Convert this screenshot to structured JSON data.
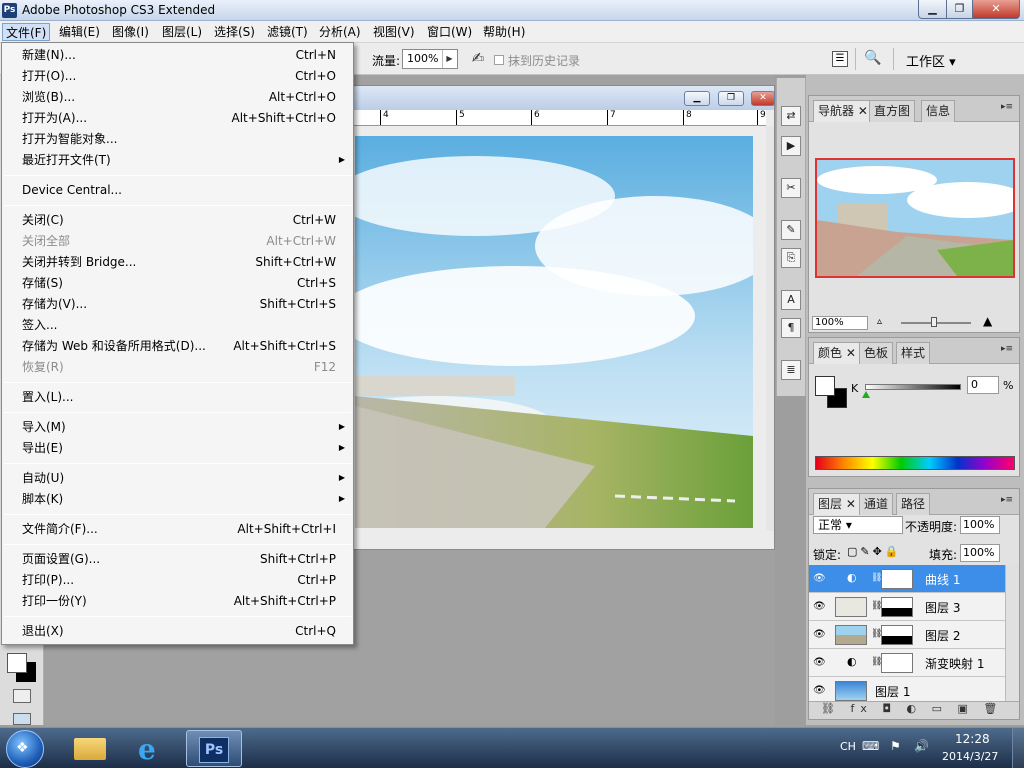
{
  "window": {
    "title": "Adobe Photoshop CS3 Extended",
    "logo": "Ps",
    "min": "▁",
    "max": "❐",
    "close": "✕"
  },
  "menubar": [
    "文件(F)",
    "编辑(E)",
    "图像(I)",
    "图层(L)",
    "选择(S)",
    "滤镜(T)",
    "分析(A)",
    "视图(V)",
    "窗口(W)",
    "帮助(H)"
  ],
  "options": {
    "flow_label": "流量:",
    "flow_value": "100%",
    "history_label": "抹到历史记录",
    "workspace": "工作区 ▾"
  },
  "file_menu": [
    {
      "label": "新建(N)...",
      "shortcut": "Ctrl+N"
    },
    {
      "label": "打开(O)...",
      "shortcut": "Ctrl+O"
    },
    {
      "label": "浏览(B)...",
      "shortcut": "Alt+Ctrl+O"
    },
    {
      "label": "打开为(A)...",
      "shortcut": "Alt+Shift+Ctrl+O"
    },
    {
      "label": "打开为智能对象...",
      "shortcut": ""
    },
    {
      "label": "最近打开文件(T)",
      "shortcut": "",
      "submenu": true
    },
    {
      "sep": true
    },
    {
      "label": "Device Central...",
      "shortcut": ""
    },
    {
      "sep": true
    },
    {
      "label": "关闭(C)",
      "shortcut": "Ctrl+W"
    },
    {
      "label": "关闭全部",
      "shortcut": "Alt+Ctrl+W",
      "disabled": true
    },
    {
      "label": "关闭并转到 Bridge...",
      "shortcut": "Shift+Ctrl+W"
    },
    {
      "label": "存储(S)",
      "shortcut": "Ctrl+S"
    },
    {
      "label": "存储为(V)...",
      "shortcut": "Shift+Ctrl+S"
    },
    {
      "label": "签入...",
      "shortcut": ""
    },
    {
      "label": "存储为 Web 和设备所用格式(D)...",
      "shortcut": "Alt+Shift+Ctrl+S"
    },
    {
      "label": "恢复(R)",
      "shortcut": "F12",
      "disabled": true
    },
    {
      "sep": true
    },
    {
      "label": "置入(L)...",
      "shortcut": ""
    },
    {
      "sep": true
    },
    {
      "label": "导入(M)",
      "shortcut": "",
      "submenu": true
    },
    {
      "label": "导出(E)",
      "shortcut": "",
      "submenu": true
    },
    {
      "sep": true
    },
    {
      "label": "自动(U)",
      "shortcut": "",
      "submenu": true
    },
    {
      "label": "脚本(K)",
      "shortcut": "",
      "submenu": true
    },
    {
      "sep": true
    },
    {
      "label": "文件简介(F)...",
      "shortcut": "Alt+Shift+Ctrl+I"
    },
    {
      "sep": true
    },
    {
      "label": "页面设置(G)...",
      "shortcut": "Shift+Ctrl+P"
    },
    {
      "label": "打印(P)...",
      "shortcut": "Ctrl+P"
    },
    {
      "label": "打印一份(Y)",
      "shortcut": "Alt+Shift+Ctrl+P"
    },
    {
      "sep": true
    },
    {
      "label": "退出(X)",
      "shortcut": "Ctrl+Q"
    }
  ],
  "ruler": [
    "4",
    "5",
    "6",
    "7",
    "8",
    "9"
  ],
  "navigator": {
    "tabs": [
      "导航器",
      "直方图",
      "信息"
    ],
    "zoom": "100%"
  },
  "color": {
    "tabs": [
      "颜色",
      "色板",
      "样式"
    ],
    "k_label": "K",
    "k_value": "0",
    "pct": "%"
  },
  "layers": {
    "tabs": [
      "图层",
      "通道",
      "路径"
    ],
    "blend_mode": "正常 ▾",
    "opacity_label": "不透明度:",
    "opacity": "100%",
    "lock_label": "锁定:",
    "fill_label": "填充:",
    "fill": "100%",
    "items": [
      {
        "name": "曲线 1",
        "selected": true
      },
      {
        "name": "图层 3"
      },
      {
        "name": "图层 2"
      },
      {
        "name": "渐变映射 1"
      },
      {
        "name": "图层 1"
      }
    ]
  },
  "taskbar": {
    "lang": "CH",
    "time": "12:28",
    "date": "2014/3/27",
    "ps_label": "Ps",
    "ie_label": "e",
    "start_glyph": "❖"
  }
}
